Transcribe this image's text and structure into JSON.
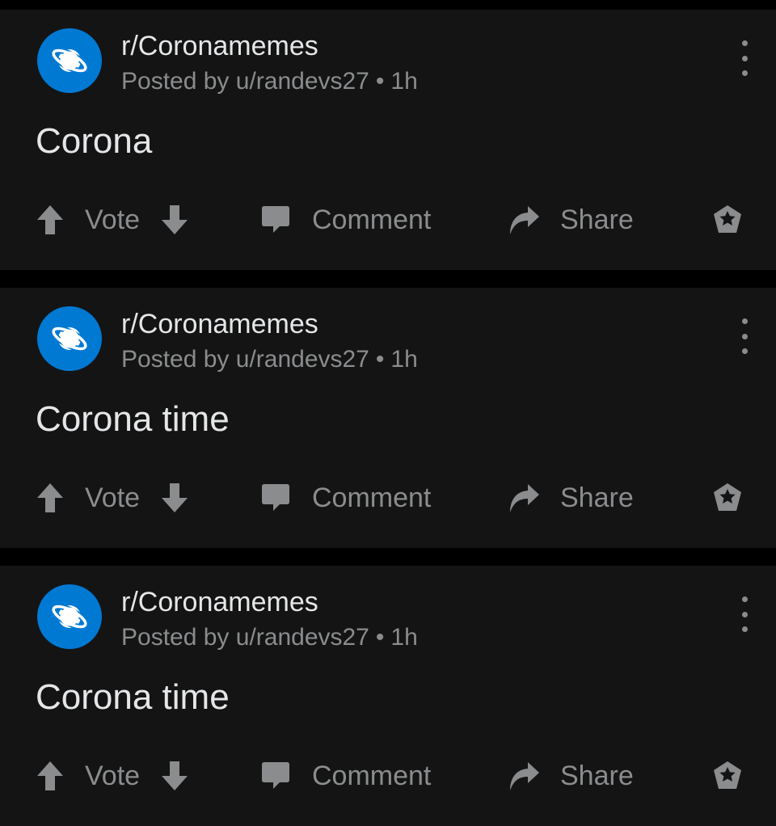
{
  "colors": {
    "background": "#000000",
    "card": "#141414",
    "accent_blue": "#0079d3",
    "text_primary": "#e4e6e8",
    "text_secondary": "#8a8c8e"
  },
  "icons": {
    "avatar": "planet-icon",
    "upvote": "arrow-up-icon",
    "downvote": "arrow-down-icon",
    "comment": "speech-bubble-icon",
    "share": "share-arrow-icon",
    "award": "award-icon",
    "more": "more-vertical-icon"
  },
  "posts": [
    {
      "subreddit": "r/Coronamemes",
      "posted_by": "Posted by u/randevs27",
      "separator": "•",
      "age": "1h",
      "title": "Corona",
      "vote_label": "Vote",
      "comment_label": "Comment",
      "share_label": "Share"
    },
    {
      "subreddit": "r/Coronamemes",
      "posted_by": "Posted by u/randevs27",
      "separator": "•",
      "age": "1h",
      "title": "Corona time",
      "vote_label": "Vote",
      "comment_label": "Comment",
      "share_label": "Share"
    },
    {
      "subreddit": "r/Coronamemes",
      "posted_by": "Posted by u/randevs27",
      "separator": "•",
      "age": "1h",
      "title": "Corona time",
      "vote_label": "Vote",
      "comment_label": "Comment",
      "share_label": "Share"
    }
  ]
}
